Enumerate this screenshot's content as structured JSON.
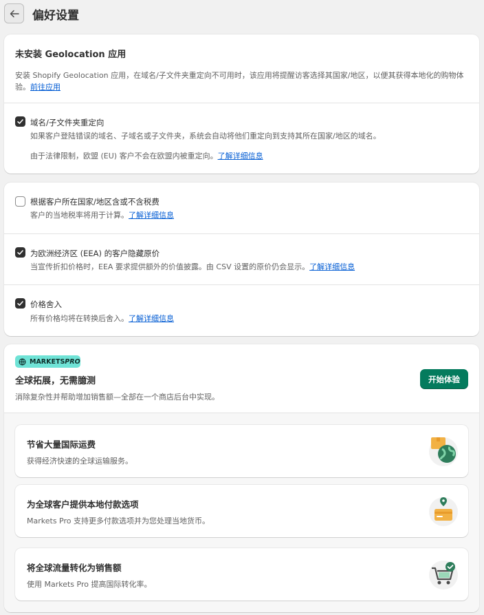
{
  "header": {
    "title": "偏好设置"
  },
  "geo": {
    "title": "未安装 Geolocation 应用",
    "desc_line1": "安装 Shopify Geolocation 应用，在域名/子文件夹重定向不可用时，该应用将提醒访客选择其国家/地区，以便其获得本地化的购物体",
    "desc_line2": "验。",
    "desc_link": "前往应用",
    "redirect_label": "域名/子文件夹重定向",
    "redirect_desc": "如果客户登陆错误的域名、子域名或子文件夹，系统会自动将他们重定向到支持其所在国家/地区的域名。",
    "eu_note": "由于法律限制，欧盟 (EU) 客户不会在欧盟内被重定向。",
    "eu_link": "了解详细信息"
  },
  "pricing": {
    "tax_label": "根据客户所在国家/地区含或不含税费",
    "tax_desc": "客户的当地税率将用于计算。",
    "tax_link": "了解详细信息",
    "eea_label": "为欧洲经济区 (EEA) 的客户隐藏原价",
    "eea_desc": "当宣传折扣价格时，EEA 要求提供额外的价值披露。由 CSV 设置的原价仍会显示。",
    "eea_link": "了解详细信息",
    "round_label": "价格舍入",
    "round_desc": "所有价格均将在转换后舍入。",
    "round_link": "了解详细信息"
  },
  "markets": {
    "badge": "MARKETS",
    "badge_pro": "PRO",
    "title": "全球拓展，无需臆测",
    "subtitle": "消除复杂性并帮助增加销售额—全部在一个商店后台中实现。",
    "cta": "开始体验",
    "features": [
      {
        "title": "节省大量国际运费",
        "desc": "获得经济快速的全球运输服务。"
      },
      {
        "title": "为全球客户提供本地付款选项",
        "desc": "Markets Pro 支持更多付款选项并为您处理当地货币。"
      },
      {
        "title": "将全球流量转化为销售额",
        "desc": "使用 Markets Pro 提高国际转化率。"
      }
    ]
  },
  "colors": {
    "accent": "#047b5d",
    "link": "#005bd3",
    "badge": "#6fe3d6"
  }
}
